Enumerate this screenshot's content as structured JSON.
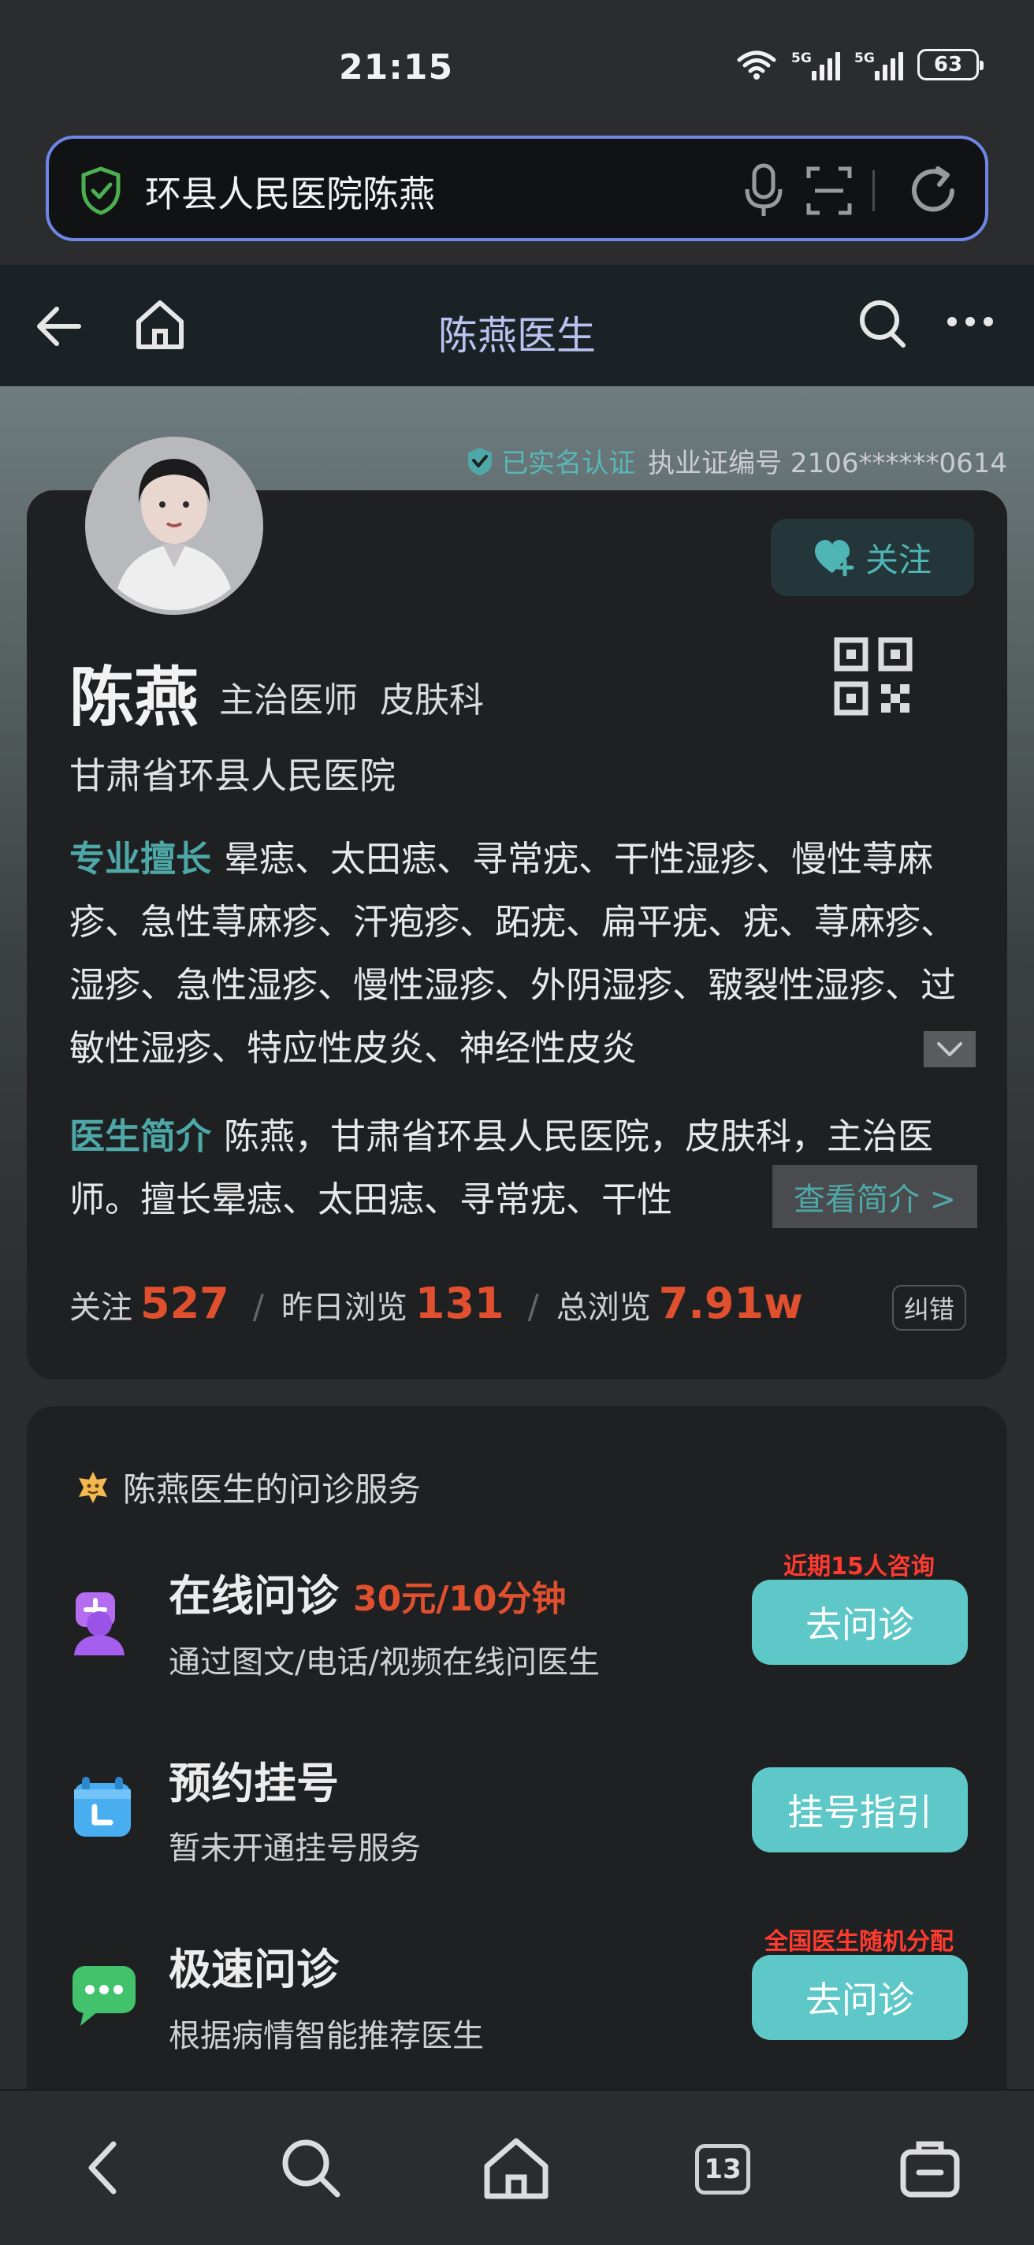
{
  "status_bar": {
    "time": "21:15",
    "net1": "5G",
    "net2": "5G",
    "battery": "63"
  },
  "search": {
    "query": "环县人民医院陈燕"
  },
  "title_bar": {
    "title": "陈燕医生"
  },
  "verification": {
    "label": "已实名认证",
    "license": "执业证编号 2106******0614"
  },
  "doctor": {
    "name": "陈燕",
    "title": "主治医师  皮肤科",
    "hospital": "甘肃省环县人民医院",
    "follow_label": "关注",
    "expertise_label": "专业擅长",
    "expertise_text": "晕痣、太田痣、寻常疣、干性湿疹、慢性荨麻疹、急性荨麻疹、汗疱疹、跖疣、扁平疣、疣、荨麻疹、湿疹、急性湿疹、慢性湿疹、外阴湿疹、皲裂性湿疹、过敏性湿疹、特应性皮炎、神经性皮炎",
    "intro_label": "医生简介",
    "intro_text": "陈燕，甘肃省环县人民医院，皮肤科，主治医师。擅长晕痣、太田痣、寻常疣、干性",
    "intro_more": "查看简介 >"
  },
  "stats": {
    "follow_label": "关注",
    "follow_value": "527",
    "yesterday_label": "昨日浏览",
    "yesterday_value": "131",
    "total_label": "总浏览",
    "total_value": "7.91w",
    "correct_label": "纠错"
  },
  "services": {
    "header": "陈燕医生的问诊服务",
    "items": [
      {
        "title": "在线问诊",
        "price": "30元/10分钟",
        "subtitle": "通过图文/电话/视频在线问医生",
        "button": "去问诊",
        "tip": "近期15人咨询",
        "icon": "online-consult-icon"
      },
      {
        "title": "预约挂号",
        "price": "",
        "subtitle": "暂未开通挂号服务",
        "button": "挂号指引",
        "tip": "",
        "icon": "calendar-icon"
      },
      {
        "title": "极速问诊",
        "price": "",
        "subtitle": "根据病情智能推荐医生",
        "button": "去问诊",
        "tip": "全国医生随机分配",
        "icon": "chat-bubble-icon"
      }
    ]
  },
  "bottom_nav": {
    "tab_count": "13"
  },
  "colors": {
    "accent": "#5ec7c7",
    "price": "#e0502f",
    "tip": "#ff3b30",
    "teal_label": "#4ea8a8",
    "search_border": "#6f86e6"
  }
}
